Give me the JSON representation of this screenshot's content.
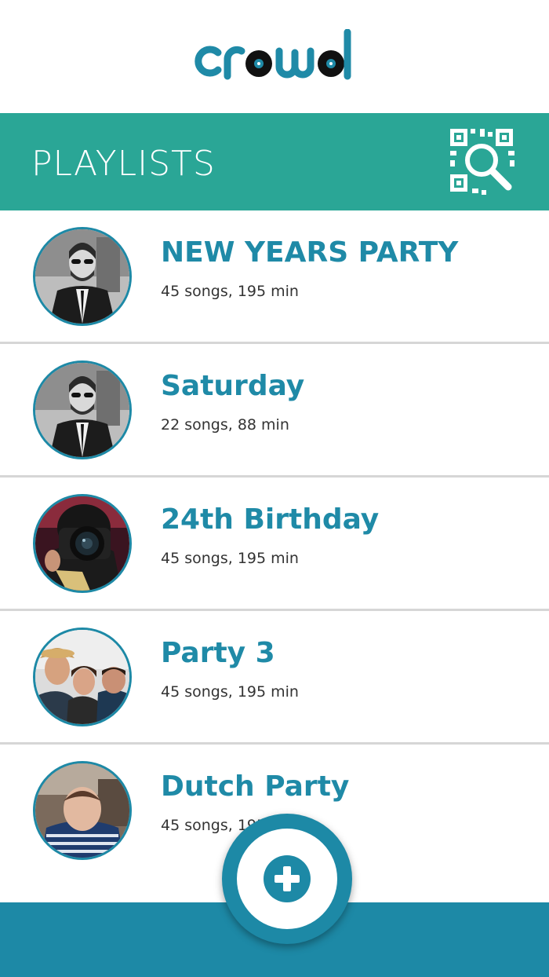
{
  "app": {
    "logo_text": "crowd",
    "brand_color": "#1f8aa7",
    "header_color": "#2aa696"
  },
  "header": {
    "title": "PLAYLISTS",
    "scan_icon": "qr-search-icon"
  },
  "playlists": [
    {
      "title": "NEW YEARS PARTY",
      "meta": "45 songs, 195 min"
    },
    {
      "title": "Saturday",
      "meta": "22 songs, 88 min"
    },
    {
      "title": "24th Birthday",
      "meta": "45 songs, 195 min"
    },
    {
      "title": "Party 3",
      "meta": "45 songs, 195 min"
    },
    {
      "title": "Dutch Party",
      "meta": "45 songs, 195 min"
    }
  ],
  "fab": {
    "icon": "plus-icon"
  }
}
